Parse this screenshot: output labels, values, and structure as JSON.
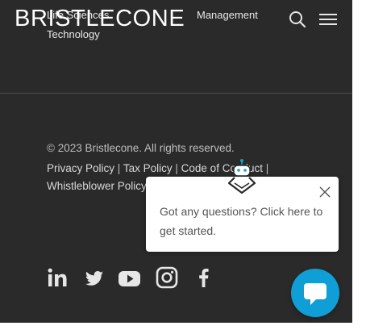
{
  "header": {
    "logo_text": "BRISTLECONE",
    "menu_items_partial": [
      "Life Sciences",
      "Technology",
      "Management"
    ]
  },
  "footer": {
    "copyright": "© 2023 Bristlecone. All rights reserved.",
    "links": [
      "Privacy Policy",
      "Tax Policy",
      "Code of Conduct",
      "Whistleblower Policy"
    ],
    "separator": "|",
    "social_icons": [
      "linkedin-icon",
      "twitter-icon",
      "youtube-icon",
      "instagram-icon",
      "facebook-icon"
    ]
  },
  "chat": {
    "message": "Got any questions? Click here to get started.",
    "accent_color": "#0f9fd6"
  },
  "colors": {
    "background": "#2a2a2a",
    "text": "#d8d8d8"
  }
}
